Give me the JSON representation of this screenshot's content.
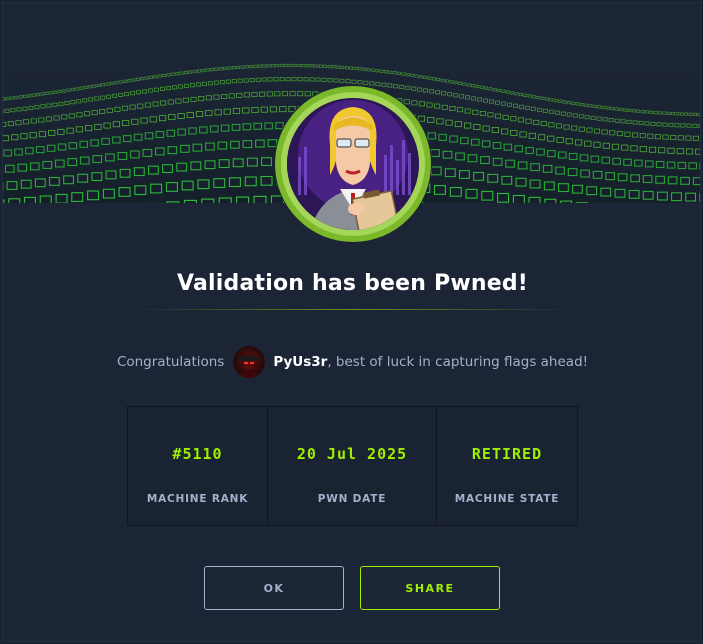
{
  "modal": {
    "title": "Validation has been Pwned!",
    "congrats_prefix": "Congratulations",
    "username": "PyUs3r",
    "congrats_suffix": ", best of luck in capturing flags ahead!"
  },
  "stats": [
    {
      "value": "#5110",
      "label": "MACHINE RANK"
    },
    {
      "value": "20 Jul 2025",
      "label": "PWN DATE"
    },
    {
      "value": "RETIRED",
      "label": "MACHINE STATE"
    }
  ],
  "buttons": {
    "ok_label": "OK",
    "share_label": "SHARE"
  },
  "colors": {
    "accent": "#9fef00",
    "background": "#1c2535",
    "muted_text": "#a4b1cd"
  },
  "icons": {
    "banner": "green-cube-wave-banner",
    "machine_avatar": "machine-avatar-validation",
    "user_avatar": "user-avatar"
  }
}
